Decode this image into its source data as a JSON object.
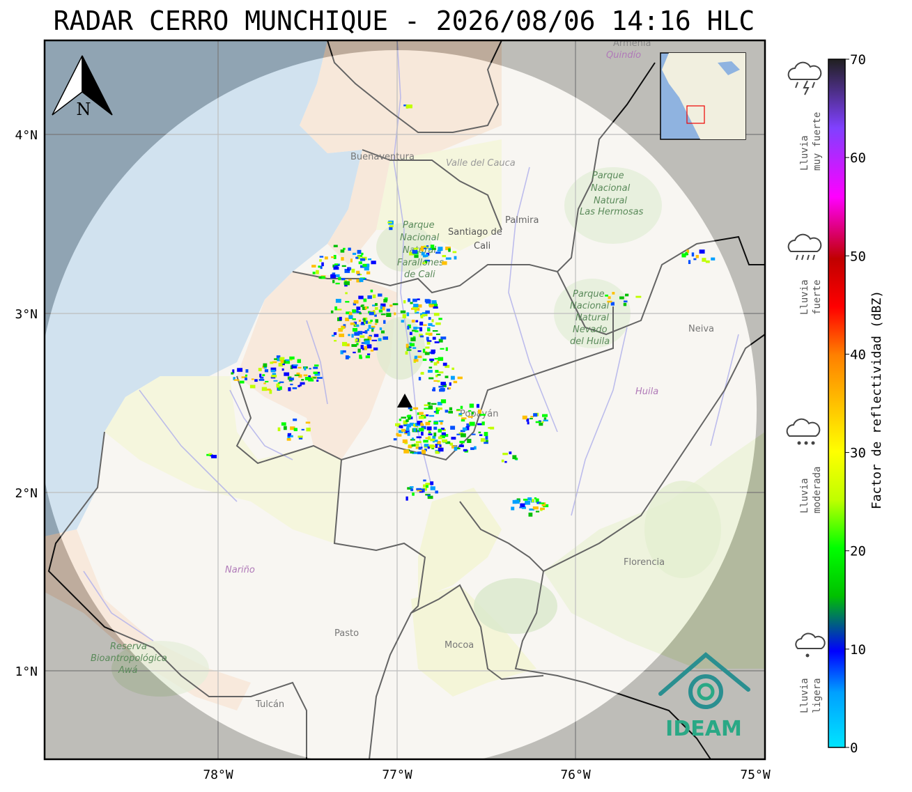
{
  "title": "RADAR CERRO MUNCHIQUE - 2026/08/06 14:16 HLC",
  "axes": {
    "x_ticks": [
      "78°W",
      "77°W",
      "76°W",
      "75°W"
    ],
    "y_ticks": [
      "4°N",
      "3°N",
      "2°N",
      "1°N"
    ]
  },
  "north_arrow": {
    "label": "N"
  },
  "places": [
    {
      "name": "Buenaventura",
      "key": "buenaventura"
    },
    {
      "name": "Valle del Cauca",
      "key": "valle"
    },
    {
      "name": "Palmira",
      "key": "palmira"
    },
    {
      "name": "Santiago de",
      "key": "cali1"
    },
    {
      "name": "Cali",
      "key": "cali2"
    },
    {
      "name": "Parque",
      "key": "pnf1"
    },
    {
      "name": "Nacional",
      "key": "pnf2"
    },
    {
      "name": "Natural",
      "key": "pnf3"
    },
    {
      "name": "Farallones",
      "key": "pnf4"
    },
    {
      "name": "de Cali",
      "key": "pnf5"
    },
    {
      "name": "Parque",
      "key": "lh1"
    },
    {
      "name": "Nacional",
      "key": "lh2"
    },
    {
      "name": "Natural",
      "key": "lh3"
    },
    {
      "name": "Las Hermosas",
      "key": "lh4"
    },
    {
      "name": "Parque",
      "key": "nh1"
    },
    {
      "name": "Nacional",
      "key": "nh2"
    },
    {
      "name": "Natural",
      "key": "nh3"
    },
    {
      "name": "Nevado",
      "key": "nh4"
    },
    {
      "name": "del Huila",
      "key": "nh5"
    },
    {
      "name": "Neiva",
      "key": "neiva"
    },
    {
      "name": "Huila",
      "key": "huila"
    },
    {
      "name": "Popayán",
      "key": "popayan"
    },
    {
      "name": "Nariño",
      "key": "narino"
    },
    {
      "name": "Pasto",
      "key": "pasto"
    },
    {
      "name": "Mocoa",
      "key": "mocoa"
    },
    {
      "name": "Florencia",
      "key": "florencia"
    },
    {
      "name": "Tulcán",
      "key": "tulcan"
    },
    {
      "name": "Reserva",
      "key": "r1"
    },
    {
      "name": "Bioantropológica",
      "key": "r2"
    },
    {
      "name": "Awá",
      "key": "r3"
    },
    {
      "name": "Armenia",
      "key": "armenia"
    },
    {
      "name": "Quindío",
      "key": "quindio"
    }
  ],
  "colorbar": {
    "label": "Factor de reflectividad (dBZ)",
    "ticks": [
      "0",
      "10",
      "20",
      "30",
      "40",
      "50",
      "60",
      "70"
    ],
    "min": 0,
    "max": 70,
    "colors": [
      "#00e5ff",
      "#0080ff",
      "#0000ff",
      "#00c000",
      "#00ff00",
      "#c0ff00",
      "#ffff00",
      "#ffc000",
      "#ff8000",
      "#ff0000",
      "#c00000",
      "#ff00ff",
      "#8040ff",
      "#202020"
    ]
  },
  "rain_legend": [
    {
      "line1": "Lluvia",
      "line2": "muy fuerte",
      "icon": "thunderstorm-icon"
    },
    {
      "line1": "Lluvia",
      "line2": "fuerte",
      "icon": "heavy-rain-icon"
    },
    {
      "line1": "Lluvia",
      "line2": "moderada",
      "icon": "moderate-rain-icon"
    },
    {
      "line1": "Lluvia",
      "line2": "ligera",
      "icon": "light-rain-icon"
    }
  ],
  "logo": {
    "text": "IDEAM"
  }
}
